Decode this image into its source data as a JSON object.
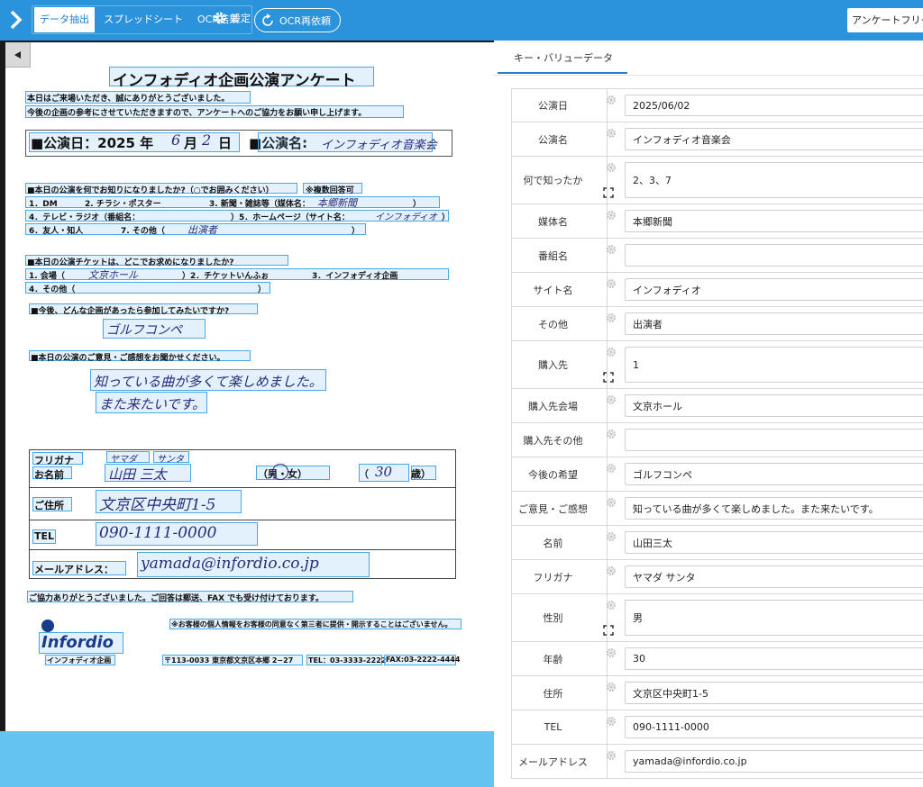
{
  "toolbar": {
    "tabs": [
      {
        "label": "データ抽出"
      },
      {
        "label": "スプレッドシート"
      },
      {
        "label": "OCR結果"
      }
    ],
    "settings_label": "設定",
    "ocr_retry_label": "OCR再依頼",
    "right_select_value": "アンケートフリー版"
  },
  "colors": {
    "accent": "#2b92dc",
    "highlight": "#4aa8e8",
    "panel_bg": "#64c3f0"
  },
  "document": {
    "title": "インフォディオ企画公演アンケート",
    "intro1": "本日はご来場いただき、誠にありがとうございました。",
    "intro2": "今後の企画の参考にさせていただきますので、アンケートへのご協力をお願い申し上げます。",
    "date_label": "■公演日：2025 年",
    "date_month": "6",
    "date_mid": "月",
    "date_day": "2",
    "date_end": "日",
    "name_label": "■公演名:",
    "name_value": "インフォディオ音楽会",
    "q1": "■本日の公演を何でお知りになりましたか?（○でお囲みください）",
    "q1_note": "※複数回答可",
    "q1_line1a": "1．DM",
    "q1_line1b": "2. チラシ・ポスター",
    "q1_line1c": "3. 新聞・雑誌等（媒体名：",
    "q1_media": "本郷新聞",
    "paren_close": "）",
    "q1_line2a": "4．テレビ・ラジオ（番組名：",
    "q1_line2b": "）5．ホームページ（サイト名：",
    "q1_site": "インフォディオ",
    "q1_line3a": "6．友人・知人",
    "q1_line3b": "7. その他（",
    "q1_other": "出演者",
    "q2": "■本日の公演チケットは、どこでお求めになりましたか?",
    "q2_line1a": "1. 会場（",
    "q2_venue": "文京ホール",
    "q2_line1b": "）2．チケットいんふぉ",
    "q2_line1c": "3．インフォディオ企画",
    "q2_line2": "4．その他（",
    "q3": "■今後、どんな企画があったら参加してみたいですか?",
    "q3_answer": "ゴルフコンペ",
    "q4": "■本日の公演のご意見・ご感想をお聞かせください。",
    "q4_answer1": "知っている曲が多くて楽しめました。",
    "q4_answer2": "また来たいです。",
    "furigana_label": "フリガナ",
    "furigana_family": "ヤマダ",
    "furigana_given": "サンタ",
    "name_field_label": "お名前",
    "person_name": "山田 三太",
    "gender": "（男・女）",
    "age_open": "（",
    "age": "30",
    "age_close": "歳）",
    "address_label": "ご住所",
    "address": "文京区中央町1-5",
    "tel_label": "TEL",
    "tel": "090-1111-0000",
    "email_label": "メールアドレス：",
    "email": "yamada@infordio.co.jp",
    "thanks": "ご協力ありがとうございました。ご回答は郵送、FAX でも受け付けております。",
    "privacy": "※お客様の個人情報をお客様の同意なく第三者に提供・開示することはございません。",
    "logo_text": "Infordio",
    "company": "インフォディオ企画",
    "postal": "〒113-0033 東京都文京区本郷 2−27",
    "company_tel": "TEL：03-3333-2222",
    "company_fax": "FAX:03-2222-4444"
  },
  "right_panel": {
    "tab_label": "キー・バリューデータ",
    "rows": [
      {
        "key": "公演日",
        "value": "2025/06/02"
      },
      {
        "key": "公演名",
        "value": "インフォディオ音楽会"
      },
      {
        "key": "何で知ったか",
        "value": "2、3、7"
      },
      {
        "key": "媒体名",
        "value": "本郷新聞"
      },
      {
        "key": "番組名",
        "value": ""
      },
      {
        "key": "サイト名",
        "value": "インフォディオ"
      },
      {
        "key": "その他",
        "value": "出演者"
      },
      {
        "key": "購入先",
        "value": "1"
      },
      {
        "key": "購入先会場",
        "value": "文京ホール"
      },
      {
        "key": "購入先その他",
        "value": ""
      },
      {
        "key": "今後の希望",
        "value": "ゴルフコンペ"
      },
      {
        "key": "ご意見・ご感想",
        "value": "知っている曲が多くて楽しめました。また来たいです。"
      },
      {
        "key": "名前",
        "value": "山田三太"
      },
      {
        "key": "フリガナ",
        "value": "ヤマダ サンタ"
      },
      {
        "key": "性別",
        "value": "男"
      },
      {
        "key": "年齢",
        "value": "30"
      },
      {
        "key": "住所",
        "value": "文京区中央町1-5"
      },
      {
        "key": "TEL",
        "value": "090-1111-0000"
      },
      {
        "key": "メールアドレス",
        "value": "yamada@infordio.co.jp"
      }
    ]
  }
}
